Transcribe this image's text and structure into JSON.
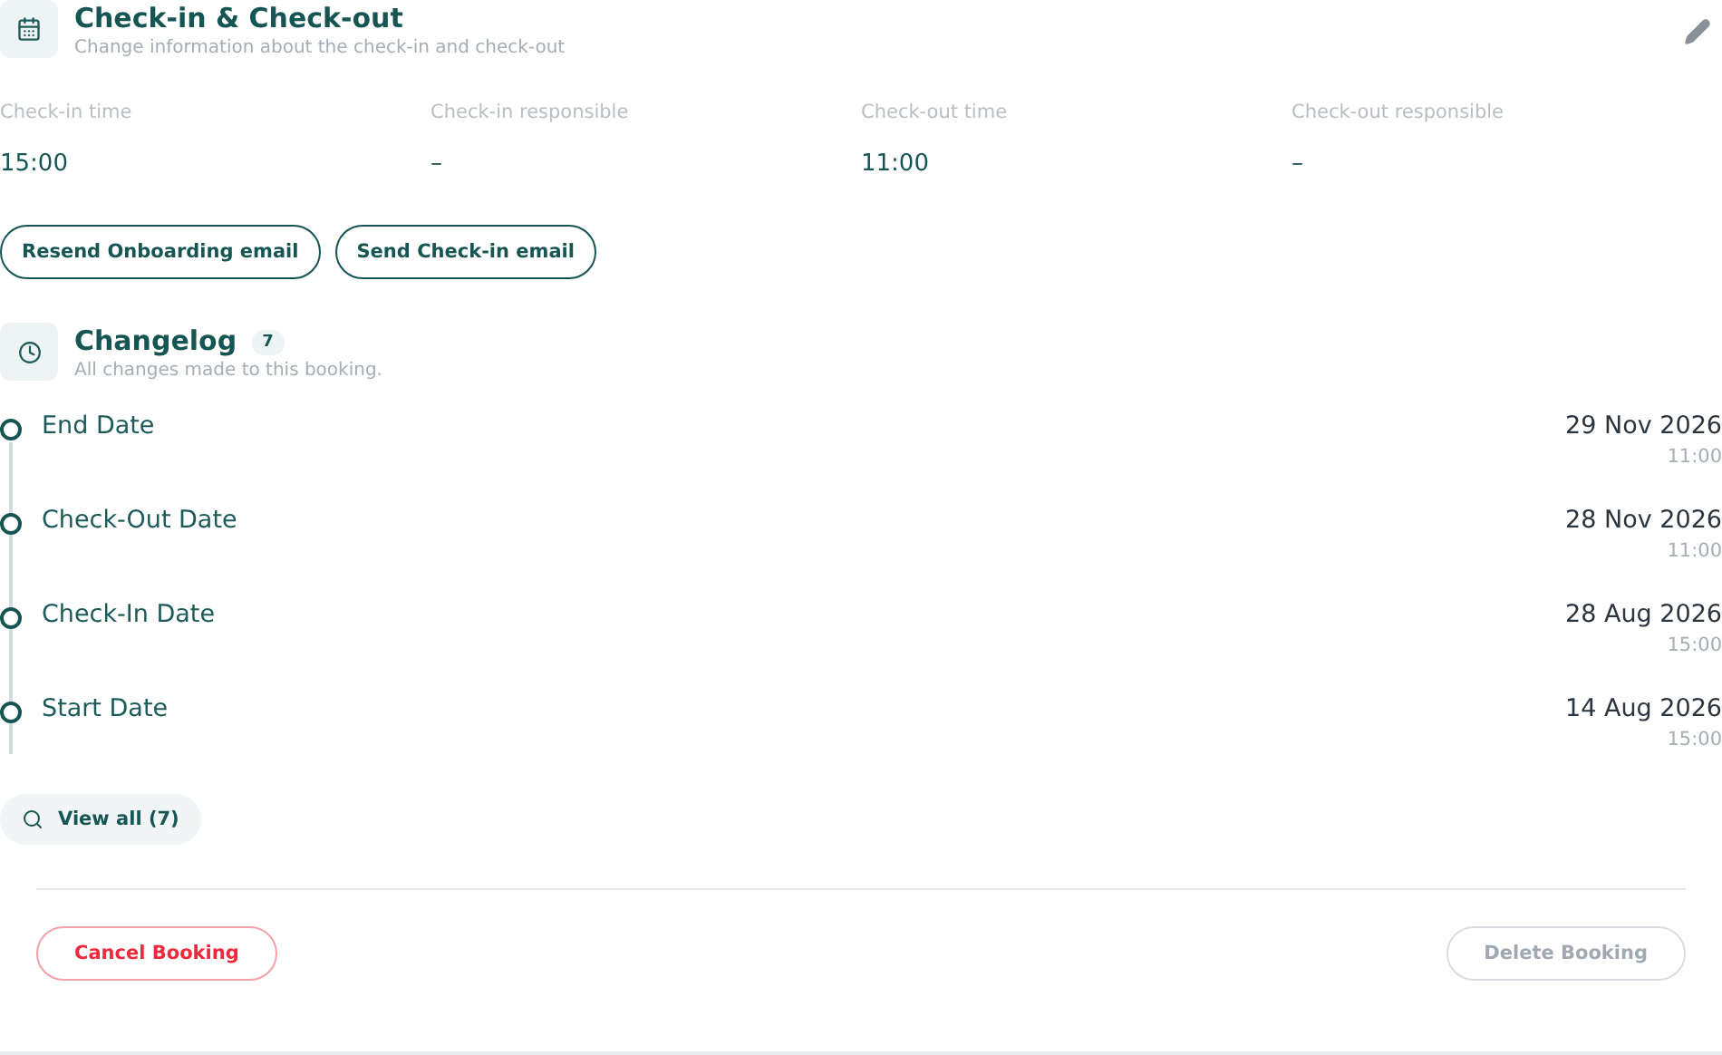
{
  "checkin_section": {
    "title": "Check-in & Check-out",
    "subtitle": "Change information about the check-in and check-out",
    "fields": [
      {
        "label": "Check-in time",
        "value": "15:00"
      },
      {
        "label": "Check-in responsible",
        "value": "–"
      },
      {
        "label": "Check-out time",
        "value": "11:00"
      },
      {
        "label": "Check-out responsible",
        "value": "–"
      }
    ],
    "buttons": [
      "Resend Onboarding email",
      "Send Check-in email"
    ]
  },
  "changelog": {
    "title": "Changelog",
    "count": "7",
    "subtitle": "All changes made to this booking.",
    "entries": [
      {
        "label": "End Date",
        "date": "29 Nov 2026",
        "time": "11:00"
      },
      {
        "label": "Check-Out Date",
        "date": "28 Nov 2026",
        "time": "11:00"
      },
      {
        "label": "Check-In Date",
        "date": "28 Aug 2026",
        "time": "15:00"
      },
      {
        "label": "Start Date",
        "date": "14 Aug 2026",
        "time": "15:00"
      }
    ],
    "view_all": "View all (7)"
  },
  "footer_buttons": [
    {
      "kind": "danger",
      "label": "Cancel Booking",
      "disabled": false
    },
    {
      "kind": "neutral",
      "label": "Delete Booking",
      "disabled": true
    }
  ]
}
